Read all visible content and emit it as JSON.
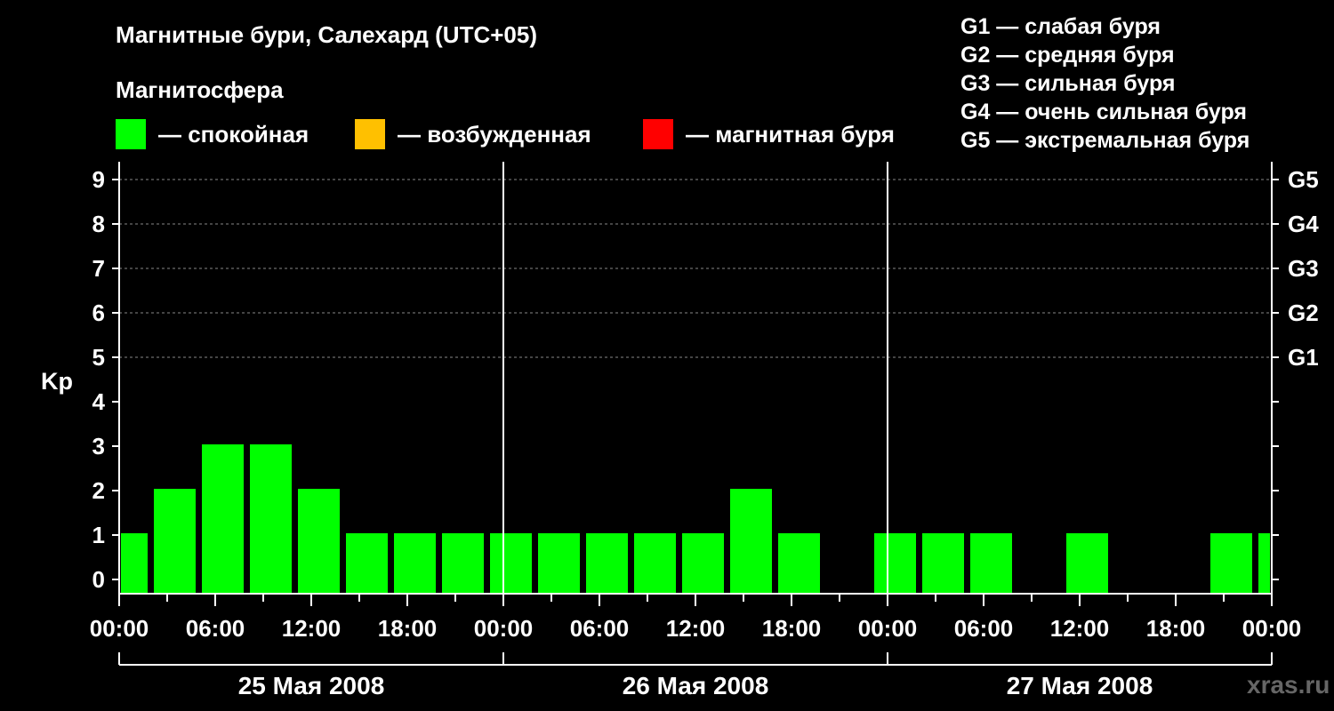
{
  "header": {
    "title": "Магнитные бури, Салехард (UTC+05)",
    "subtitle": "Магнитосфера"
  },
  "legend": [
    {
      "label": "— спокойная",
      "color": "#00ff00"
    },
    {
      "label": "— возбужденная",
      "color": "#ffc000"
    },
    {
      "label": "— магнитная буря",
      "color": "#ff0000"
    }
  ],
  "storm_levels": [
    "G1 — слабая буря",
    "G2 — средняя буря",
    "G3 — сильная буря",
    "G4 — очень сильная буря",
    "G5 — экстремальная буря"
  ],
  "watermark": "xras.ru",
  "chart_data": {
    "type": "bar",
    "title": "Магнитные бури, Салехард (UTC+05)",
    "ylabel": "Kp",
    "ylim": [
      0,
      9
    ],
    "yticks": [
      0,
      1,
      2,
      3,
      4,
      5,
      6,
      7,
      8,
      9
    ],
    "right_axis_labels": [
      {
        "kp": 5,
        "label": "G1"
      },
      {
        "kp": 6,
        "label": "G2"
      },
      {
        "kp": 7,
        "label": "G3"
      },
      {
        "kp": 8,
        "label": "G4"
      },
      {
        "kp": 9,
        "label": "G5"
      }
    ],
    "xtick_labels": [
      "00:00",
      "06:00",
      "12:00",
      "18:00",
      "00:00",
      "06:00",
      "12:00",
      "18:00",
      "00:00",
      "06:00",
      "12:00",
      "18:00",
      "00:00"
    ],
    "days": [
      "25 Мая 2008",
      "26 Мая 2008",
      "27 Мая 2008"
    ],
    "bar_interval_hours": 3,
    "bar_start_hour": -1,
    "grid": "dashed horizontal at Kp 5-9",
    "values": [
      1,
      2,
      3,
      3,
      2,
      1,
      1,
      1,
      1,
      1,
      1,
      1,
      1,
      2,
      1,
      0,
      1,
      1,
      1,
      0,
      1,
      0,
      0,
      1,
      1
    ],
    "colors": {
      "quiet": "#00ff00",
      "active": "#ffc000",
      "storm": "#ff0000"
    }
  }
}
